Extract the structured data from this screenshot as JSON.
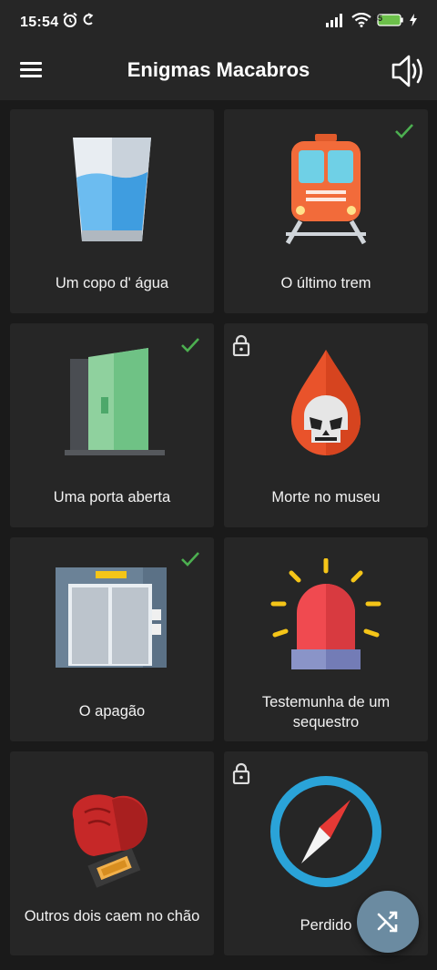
{
  "status_bar": {
    "time": "15:54",
    "battery": "85"
  },
  "app_bar": {
    "title": "Enigmas Macabros"
  },
  "puzzles": [
    {
      "title": "Um copo d' água",
      "icon": "glass-of-water-icon",
      "solved": false,
      "locked": false
    },
    {
      "title": "O último trem",
      "icon": "train-icon",
      "solved": true,
      "locked": false
    },
    {
      "title": "Uma porta aberta",
      "icon": "open-door-icon",
      "solved": true,
      "locked": false
    },
    {
      "title": "Morte no museu",
      "icon": "skull-drop-icon",
      "solved": false,
      "locked": true
    },
    {
      "title": "O apagão",
      "icon": "elevator-icon",
      "solved": true,
      "locked": false
    },
    {
      "title": "Testemunha de um sequestro",
      "icon": "siren-icon",
      "solved": false,
      "locked": false
    },
    {
      "title": "Outros dois caem no chão",
      "icon": "boxing-gloves-icon",
      "solved": false,
      "locked": false
    },
    {
      "title": "Perdido",
      "icon": "compass-icon",
      "solved": false,
      "locked": true
    }
  ],
  "fab": {
    "icon": "shuffle-icon"
  },
  "colors": {
    "background": "#1a1a1a",
    "card": "#262626",
    "check": "#4caf50",
    "fab": "#6b8ba1"
  }
}
